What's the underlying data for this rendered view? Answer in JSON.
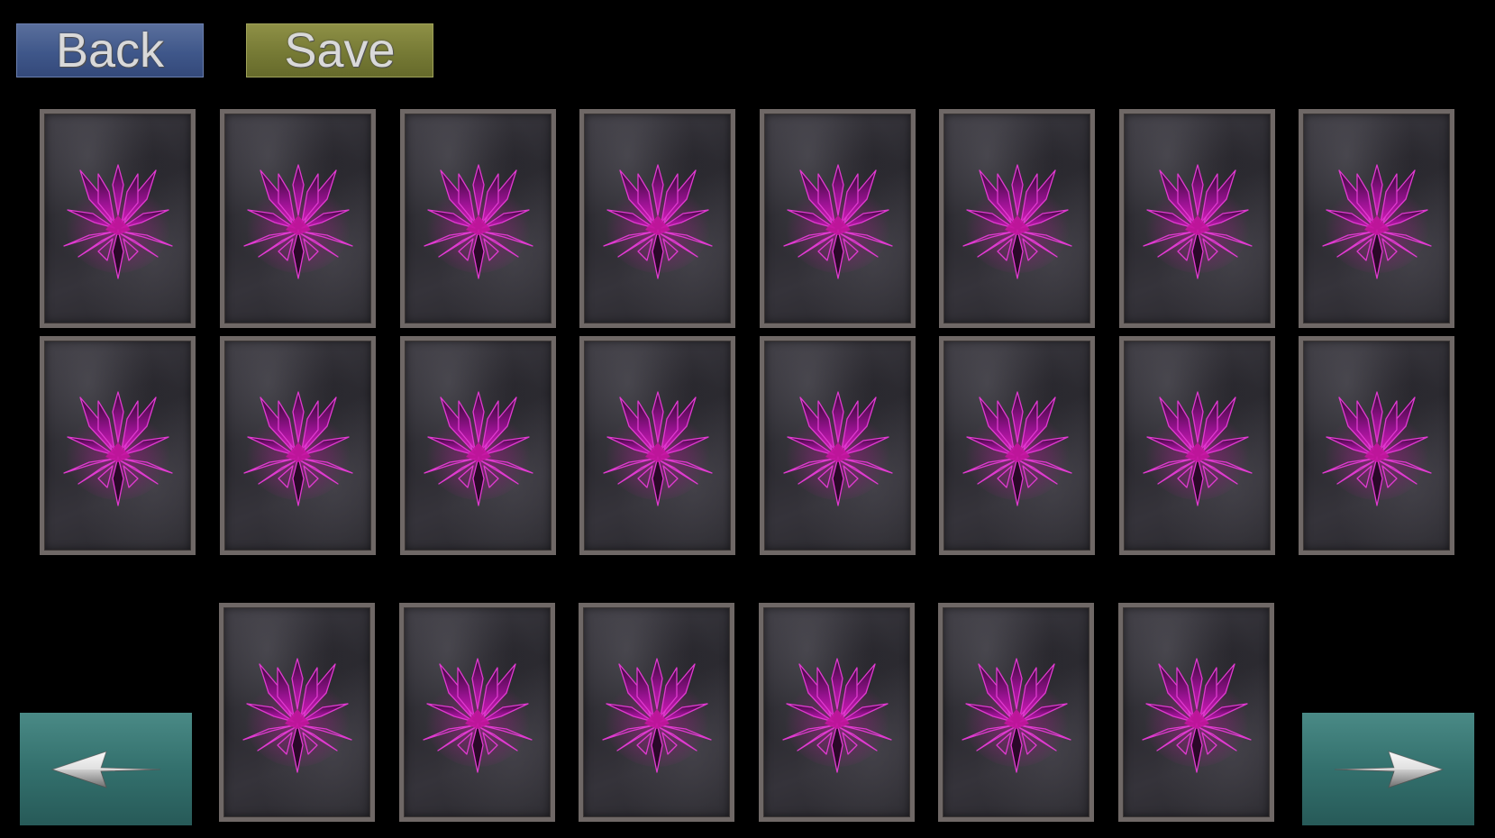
{
  "toolbar": {
    "back_label": "Back",
    "save_label": "Save"
  },
  "deck": {
    "rows": [
      {
        "cards": [
          "card-back",
          "card-back",
          "card-back",
          "card-back",
          "card-back",
          "card-back",
          "card-back",
          "card-back"
        ]
      },
      {
        "cards": [
          "card-back",
          "card-back",
          "card-back",
          "card-back",
          "card-back",
          "card-back",
          "card-back",
          "card-back"
        ]
      }
    ]
  },
  "hand": {
    "cards": [
      "card-back",
      "card-back",
      "card-back",
      "card-back",
      "card-back",
      "card-back"
    ]
  },
  "navigation": {
    "previous_icon": "arrow-left-icon",
    "next_icon": "arrow-right-icon"
  },
  "colors": {
    "back_button": "#3f578a",
    "save_button": "#767a35",
    "nav_button": "#33706d",
    "card_emblem": "#b0129e"
  }
}
